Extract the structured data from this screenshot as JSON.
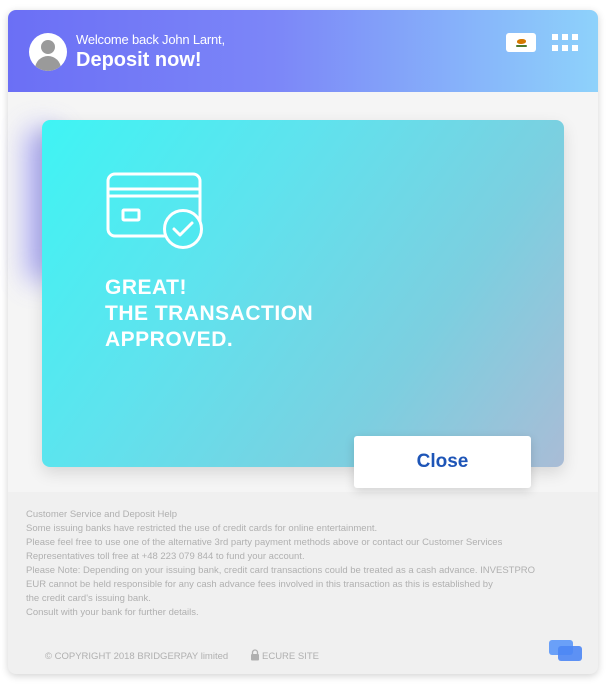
{
  "header": {
    "welcome_text": "Welcome back John Larnt,",
    "title": "Deposit now!",
    "avatar_icon": "user-avatar-icon",
    "flag_icon": "cyprus-flag-icon",
    "menu_icon": "grid-menu-icon"
  },
  "card": {
    "icon": "credit-card-check-icon",
    "message_lines": [
      "GREAT!",
      "THE TRANSACTION",
      "APPROVED."
    ],
    "close_label": "Close"
  },
  "help": {
    "lines": [
      "Customer Service and Deposit Help",
      "Some issuing banks have restricted the use of credit cards for online entertainment.",
      "Please feel free to use one of the alternative 3rd party payment methods above or contact our Customer Services",
      "Representatives toll free at +48 223 079 844 to fund your account.",
      "Please Note: Depending on your issuing bank, credit card transactions could be treated as a cash advance. INVESTPRO",
      "EUR cannot be held responsible for any cash advance fees involved in this transaction as this is established by",
      "the credit card's issuing bank.",
      "Consult with your bank for further details."
    ]
  },
  "footer": {
    "copyright": "© COPYRIGHT 2018 BRIDGERPAY limited",
    "secure_label": "ECURE SITE",
    "lock_icon": "lock-icon",
    "chat_icon": "chat-icon"
  },
  "colors": {
    "header_start": "#6b6ff5",
    "header_end": "#8ed2fb",
    "card_start": "#3ff4f4",
    "card_end": "#a9bcd6",
    "close_text": "#1e55b7"
  }
}
